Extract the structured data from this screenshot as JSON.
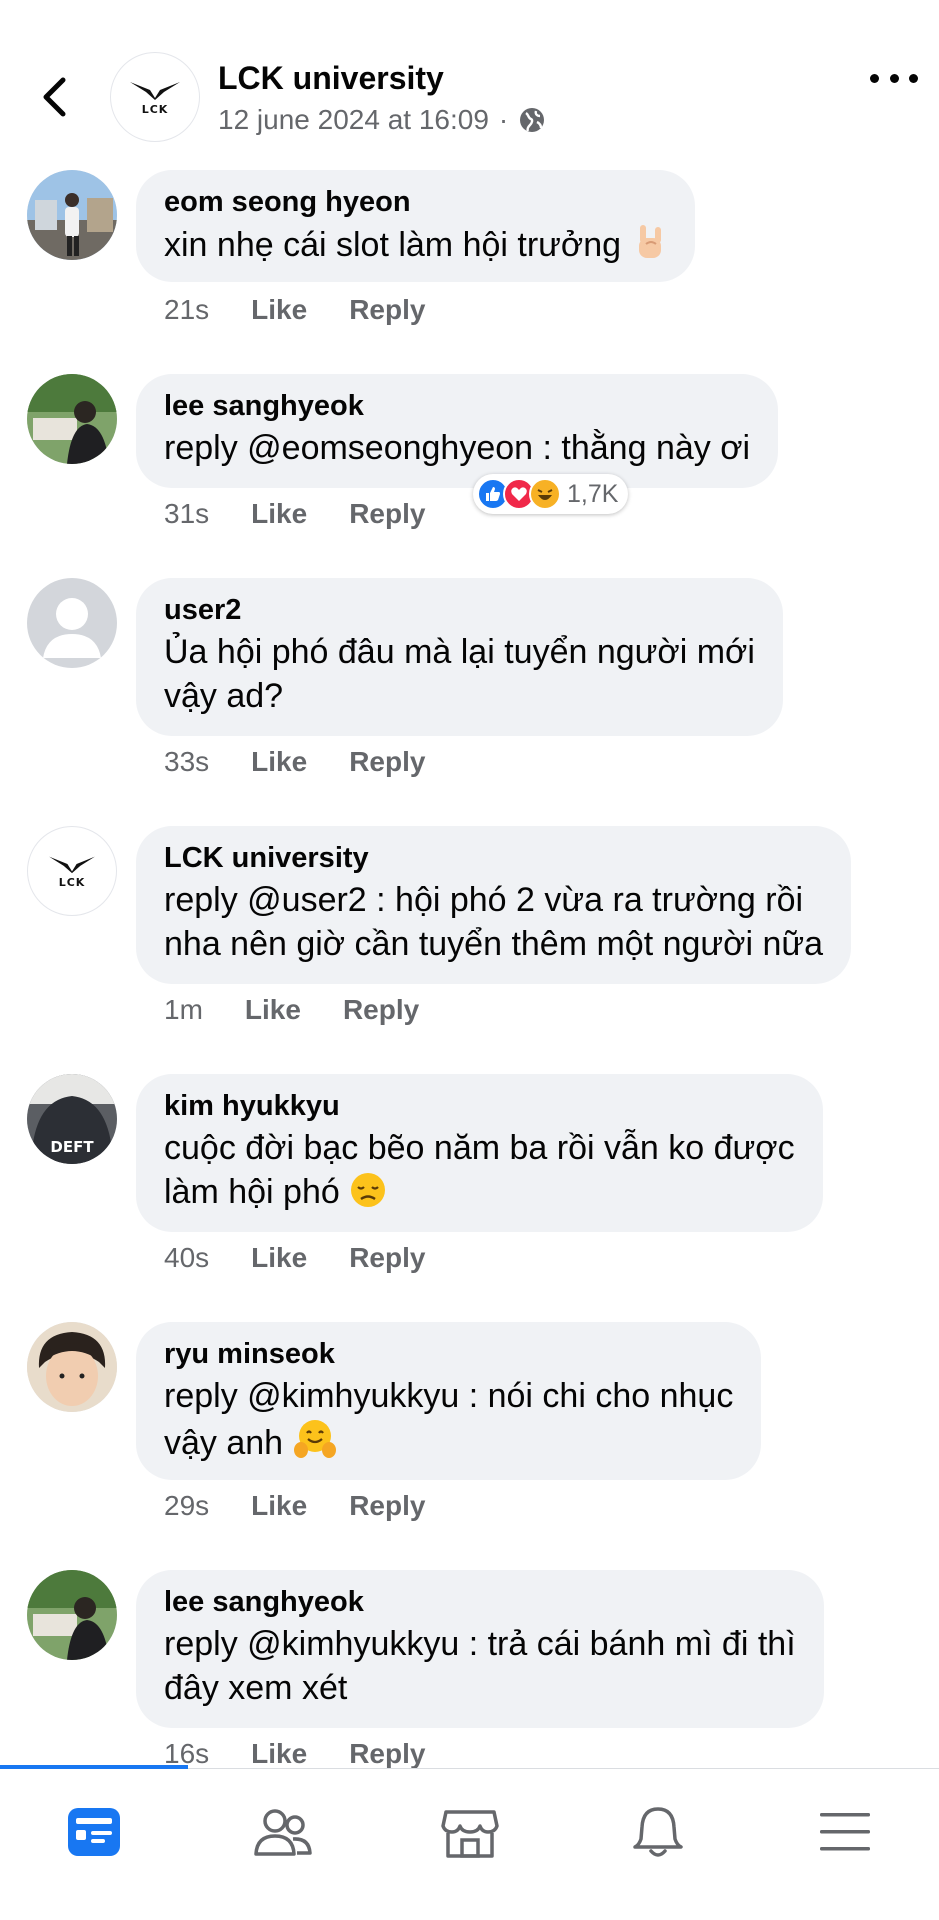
{
  "header": {
    "page_name": "LCK university",
    "date": "12 june 2024 at 16:09",
    "separator": "·",
    "logo_text": "LCK",
    "privacy_icon": "globe-icon"
  },
  "comments": [
    {
      "name": "eom seong hyeon",
      "text": "xin nhẹ cái slot làm hội trưởng",
      "emoji": "rock-hand",
      "time": "21s",
      "like": "Like",
      "reply": "Reply"
    },
    {
      "name": "lee sanghyeok",
      "text": "reply @eomseonghyeon : thằng này ơi",
      "time": "31s",
      "like": "Like",
      "reply": "Reply",
      "reaction_count": "1,7K",
      "reactions": [
        "like",
        "love",
        "haha"
      ]
    },
    {
      "name": "user2",
      "text": "Ủa hội phó đâu mà lại tuyển người mới\nvậy ad?",
      "time": "33s",
      "like": "Like",
      "reply": "Reply"
    },
    {
      "name": "LCK university",
      "text": "reply @user2 : hội phó 2 vừa ra trường rồi\nnha nên giờ cần tuyển thêm một người nữa",
      "time": "1m",
      "like": "Like",
      "reply": "Reply"
    },
    {
      "name": "kim hyukkyu",
      "text": "cuộc đời bạc bẽo năm ba rồi vẫn ko được\nlàm hội phó",
      "emoji": "disappointed-face",
      "time": "40s",
      "like": "Like",
      "reply": "Reply",
      "avatar_text": "DEFT"
    },
    {
      "name": "ryu minseok",
      "text": "reply @kimhyukkyu : nói chi cho nhục\nvậy anh",
      "emoji": "hugging-face",
      "time": "29s",
      "like": "Like",
      "reply": "Reply"
    },
    {
      "name": "lee sanghyeok",
      "text": "reply @kimhyukkyu : trả cái bánh mì đi thì\nđây xem xét",
      "time": "16s",
      "like": "Like",
      "reply": "Reply"
    }
  ],
  "tabbar": {
    "items": [
      "news-feed-icon",
      "friends-icon",
      "marketplace-icon",
      "notifications-icon",
      "menu-icon"
    ],
    "active": "news-feed-icon",
    "accent": "#1877f2"
  }
}
